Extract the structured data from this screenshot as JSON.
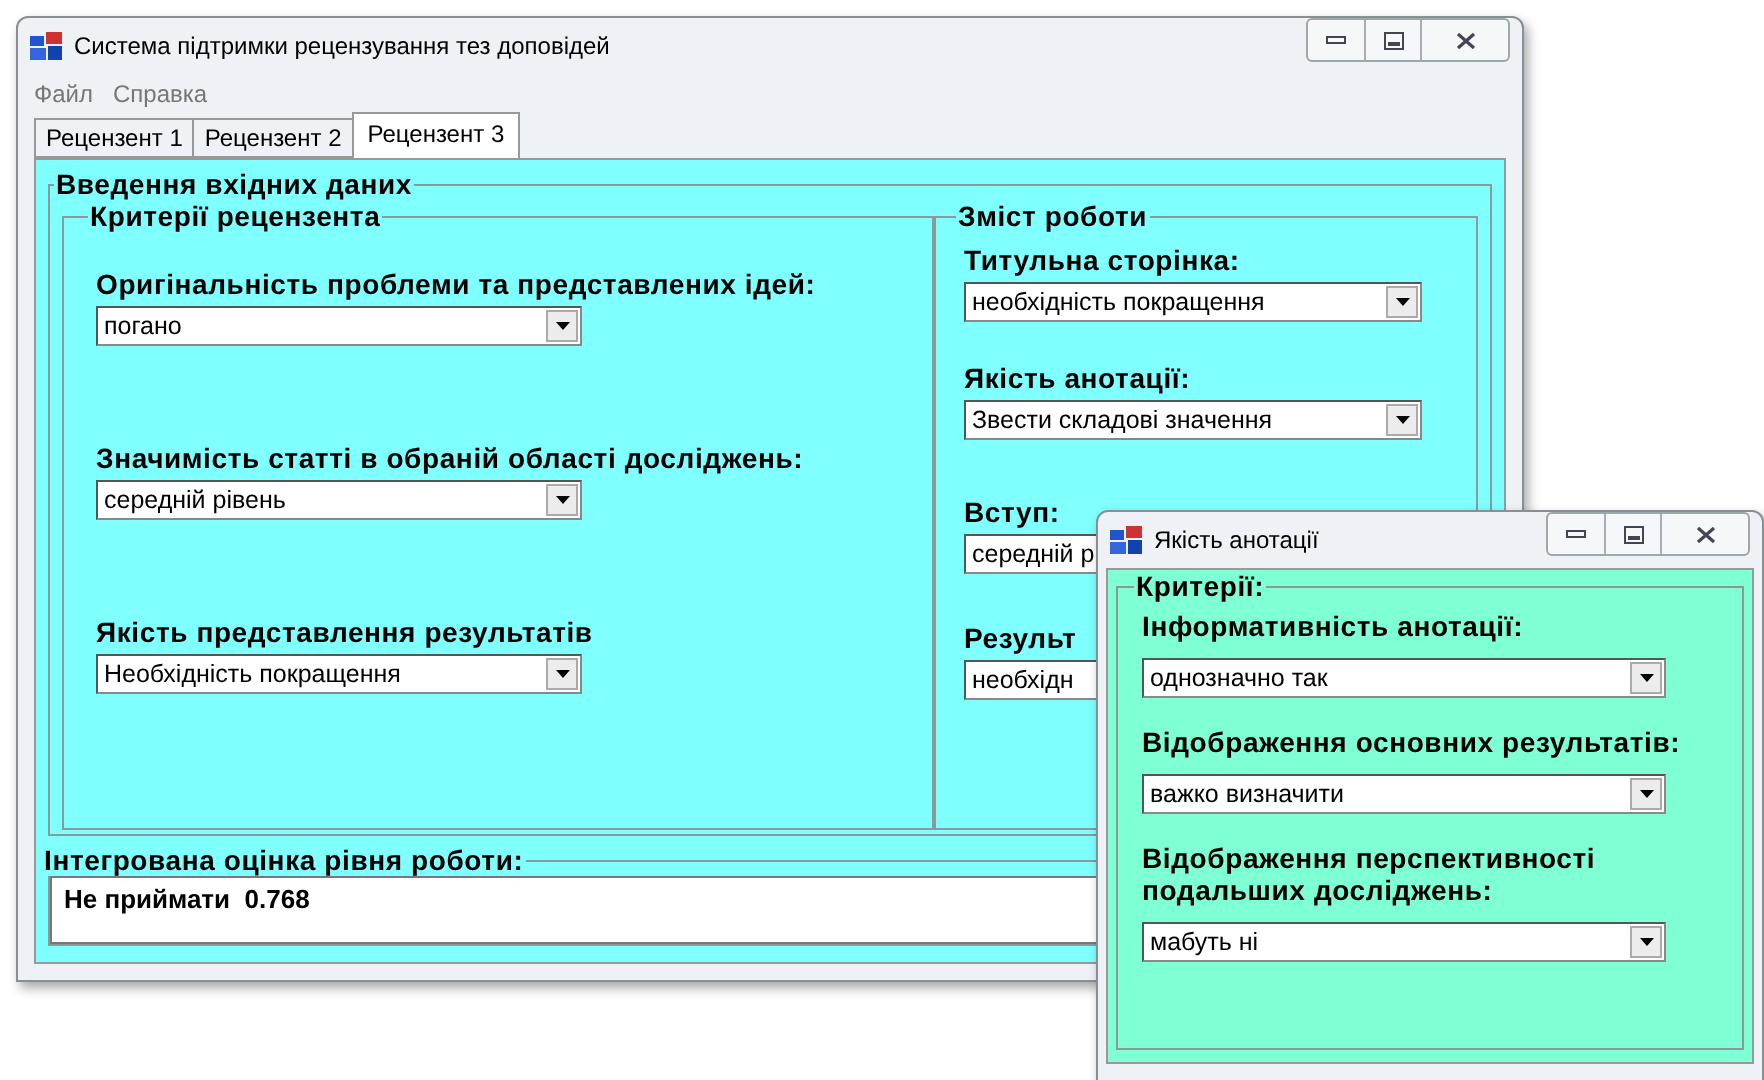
{
  "main_window": {
    "title": "Система підтримки рецензування тез доповідей",
    "menu": [
      "Файл",
      "Справка"
    ],
    "tabs": [
      {
        "label": "Рецензент 1",
        "selected": false
      },
      {
        "label": "Рецензент 2",
        "selected": false
      },
      {
        "label": "Рецензент 3",
        "selected": true
      }
    ],
    "input_group": {
      "title": "Введення вхідних даних",
      "criteria": {
        "title": "Критерії рецензента",
        "fields": [
          {
            "label": "Оригінальність проблеми та представлених ідей:",
            "value": "погано"
          },
          {
            "label": "Значимість статті в обраній області досліджень:",
            "value": "середній рівень"
          },
          {
            "label": "Якість представлення результатів",
            "value": "Необхідність покращення"
          }
        ]
      },
      "content": {
        "title": "Зміст роботи",
        "fields": [
          {
            "label": "Титульна сторінка:",
            "value": "необхідність покращення"
          },
          {
            "label": "Якість анотації:",
            "value": "Звести складові значення"
          },
          {
            "label": "Вступ:",
            "value": "середній р"
          },
          {
            "label": "Результ",
            "value": "необхідн"
          }
        ]
      }
    },
    "result": {
      "title": "Інтегрована оцінка рівня роботи:",
      "value": "Не приймати  0.768"
    }
  },
  "dialog": {
    "title": "Якість анотації",
    "group_title": "Критерії:",
    "fields": [
      {
        "label": "Інформативність анотації:",
        "value": "однозначно так"
      },
      {
        "label": "Відображення основних результатів:",
        "value": "важко визначити"
      },
      {
        "label": "Відображення перспективності подальших досліджень:",
        "value": "мабуть ні"
      }
    ]
  }
}
